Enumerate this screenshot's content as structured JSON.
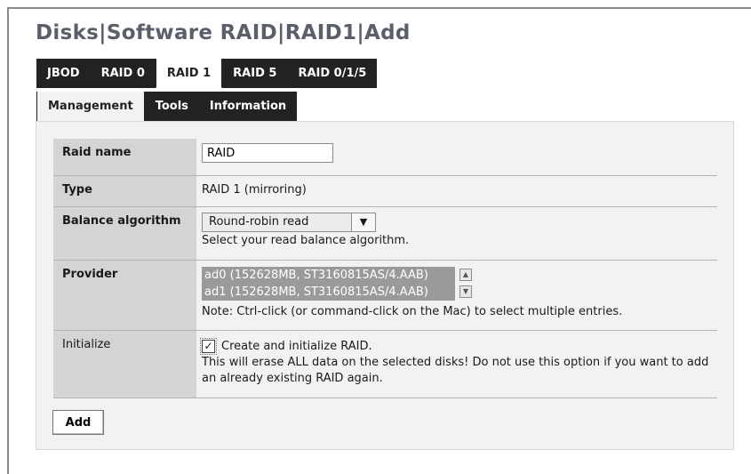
{
  "page": {
    "title": "Disks|Software RAID|RAID1|Add"
  },
  "tabs_primary": [
    {
      "label": "JBOD",
      "active": false
    },
    {
      "label": "RAID 0",
      "active": false
    },
    {
      "label": "RAID 1",
      "active": true
    },
    {
      "label": "RAID 5",
      "active": false
    },
    {
      "label": "RAID 0/1/5",
      "active": false
    }
  ],
  "tabs_secondary": [
    {
      "label": "Management",
      "active": true
    },
    {
      "label": "Tools",
      "active": false
    },
    {
      "label": "Information",
      "active": false
    }
  ],
  "form": {
    "raid_name": {
      "label": "Raid name",
      "value": "RAID"
    },
    "type": {
      "label": "Type",
      "value": "RAID 1 (mirroring)"
    },
    "balance": {
      "label": "Balance algorithm",
      "selected": "Round-robin read",
      "hint": "Select your read balance algorithm."
    },
    "provider": {
      "label": "Provider",
      "options": [
        "ad0 (152628MB, ST3160815AS/4.AAB)",
        "ad1 (152628MB, ST3160815AS/4.AAB)"
      ],
      "note": "Note: Ctrl-click (or command-click on the Mac) to select multiple entries."
    },
    "initialize": {
      "label": "Initialize",
      "checked": true,
      "checkbox_label": "Create and initialize RAID.",
      "warning": "This will erase ALL data on the selected disks! Do not use this option if you want to add an already existing RAID again."
    }
  },
  "actions": {
    "add_label": "Add"
  },
  "icons": {
    "dropdown": "chevron-down-icon",
    "scroll_up": "scroll-up-icon",
    "scroll_down": "scroll-down-icon",
    "check": "check-icon"
  }
}
